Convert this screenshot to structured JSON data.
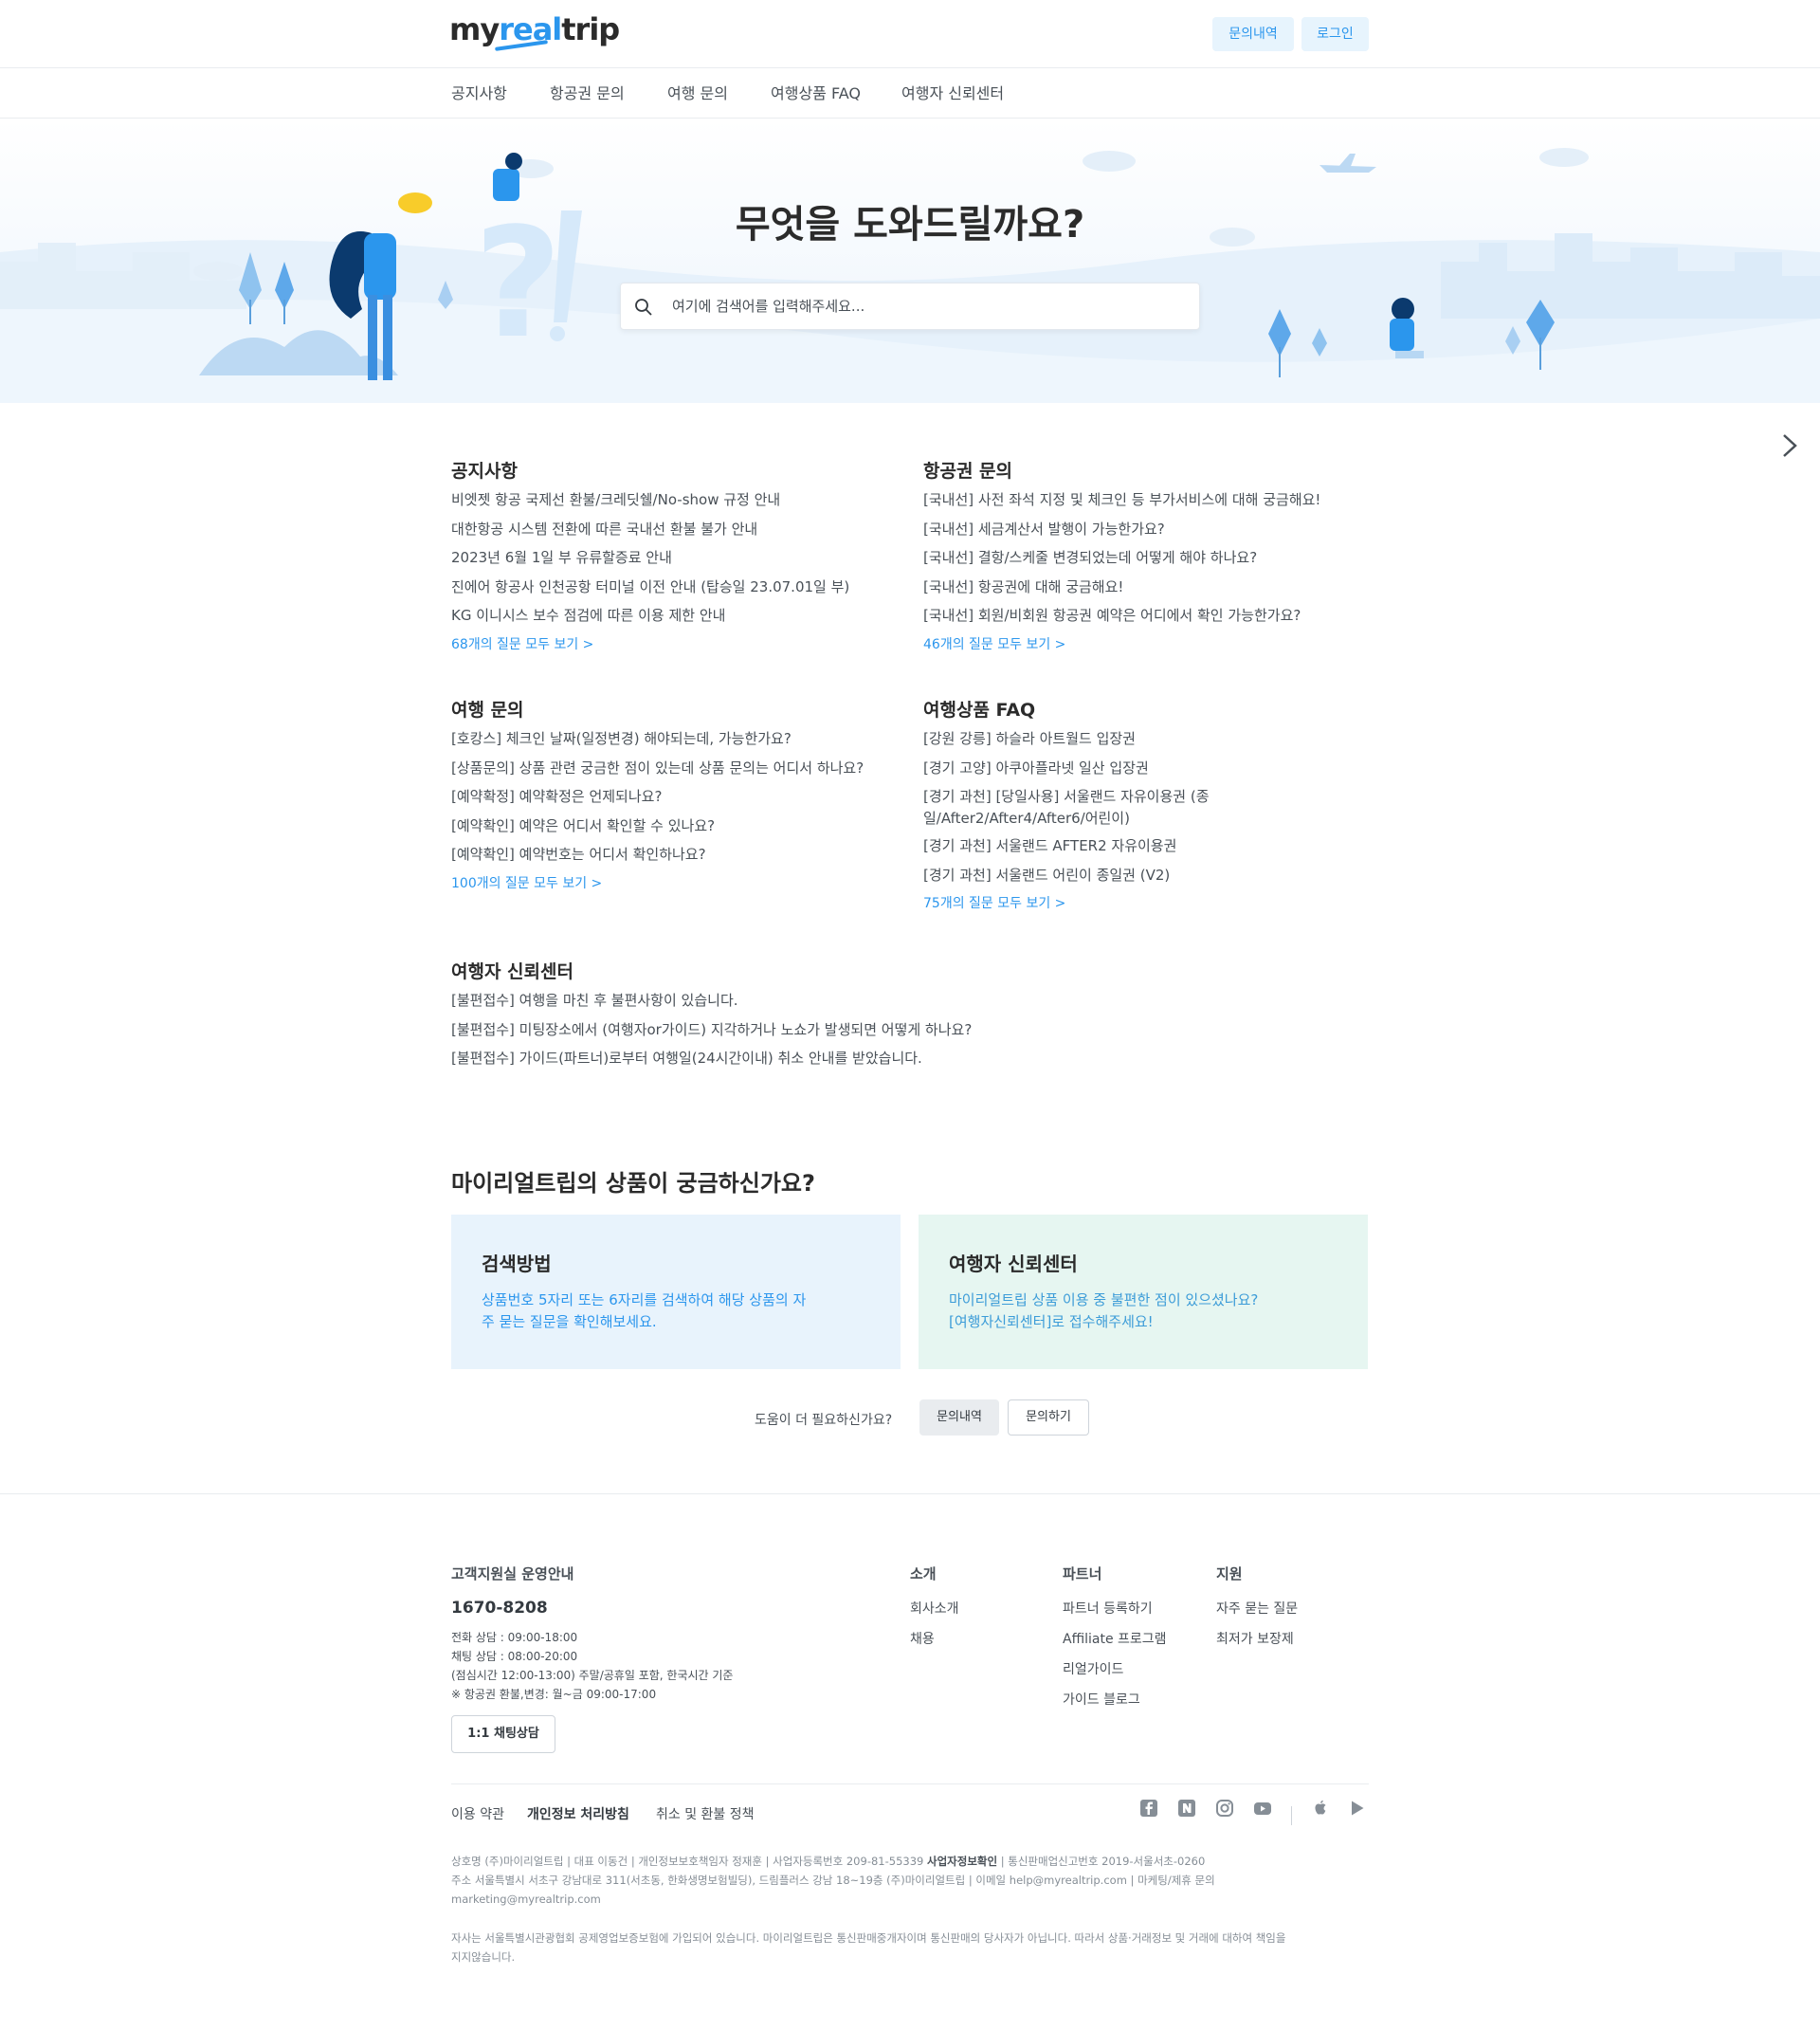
{
  "header": {
    "logo_my": "my",
    "logo_real": "real",
    "logo_trip": "trip",
    "inquiry_button": "문의내역",
    "login_button": "로그인"
  },
  "nav": {
    "items": [
      "공지사항",
      "항공권 문의",
      "여행 문의",
      "여행상품 FAQ",
      "여행자 신뢰센터"
    ]
  },
  "hero": {
    "title": "무엇을 도와드릴까요?",
    "search_placeholder": "여기에 검색어를 입력해주세요..."
  },
  "sections": {
    "notice": {
      "title": "공지사항",
      "items": [
        "비엣젯 항공 국제선 환불/크레딧쉘/No-show 규정 안내",
        "대한항공 시스템 전환에 따른 국내선 환불 불가 안내",
        "2023년 6월 1일 부 유류할증료 안내",
        "진에어 항공사 인천공항 터미널 이전 안내 (탑승일 23.07.01일 부)",
        "KG 이니시스 보수 점검에 따른 이용 제한 안내"
      ],
      "more": "68개의 질문 모두 보기 >"
    },
    "flight": {
      "title": "항공권 문의",
      "items": [
        "[국내선] 사전 좌석 지정 및 체크인 등 부가서비스에 대해 궁금해요!",
        "[국내선] 세금계산서 발행이 가능한가요?",
        "[국내선] 결항/스케줄 변경되었는데 어떻게 해야 하나요?",
        "[국내선] 항공권에 대해 궁금해요!",
        "[국내선] 회원/비회원 항공권 예약은 어디에서 확인 가능한가요?"
      ],
      "more": "46개의 질문 모두 보기 >"
    },
    "travel": {
      "title": "여행 문의",
      "items": [
        "[호캉스] 체크인 날짜(일정변경) 해야되는데, 가능한가요?",
        "[상품문의] 상품 관련 궁금한 점이 있는데 상품 문의는 어디서 하나요?",
        "[예약확정] 예약확정은 언제되나요?",
        "[예약확인] 예약은 어디서 확인할 수 있나요?",
        "[예약확인] 예약번호는 어디서 확인하나요?"
      ],
      "more": "100개의 질문 모두 보기 >"
    },
    "product_faq": {
      "title": "여행상품 FAQ",
      "items": [
        "[강원 강릉] 하슬라 아트월드 입장권",
        "[경기 고양] 아쿠아플라넷 일산 입장권",
        "[경기 과천] [당일사용] 서울랜드 자유이용권 (종일/After2/After4/After6/어린이)",
        "[경기 과천] 서울랜드 AFTER2 자유이용권",
        "[경기 과천] 서울랜드 어린이 종일권 (V2)"
      ],
      "more": "75개의 질문 모두 보기 >"
    },
    "trust": {
      "title": "여행자 신뢰센터",
      "items": [
        "[불편접수] 여행을 마친 후 불편사항이 있습니다.",
        "[불편접수] 미팅장소에서 (여행자or가이드) 지각하거나 노쇼가 발생되면 어떻게 하나요?",
        "[불편접수] 가이드(파트너)로부터 여행일(24시간이내) 취소 안내를 받았습니다."
      ]
    }
  },
  "products": {
    "title": "마이리얼트립의 상품이 궁금하신가요?",
    "search_card": {
      "title": "검색방법",
      "line1": "상품번호 5자리 또는 6자리를 검색하여 해당 상품의 자",
      "line2": "주 묻는 질문을 확인해보세요."
    },
    "trust_card": {
      "title": "여행자 신뢰센터",
      "line1": "마이리얼트립 상품 이용 중 불편한 점이 있으셨나요?",
      "line2": "[여행자신뢰센터]로 접수해주세요!"
    }
  },
  "help": {
    "text": "도움이 더 필요하신가요?",
    "inquiry_button": "문의내역",
    "ask_button": "문의하기"
  },
  "footer": {
    "cs_title": "고객지원실 운영안내",
    "phone": "1670-8208",
    "hours": [
      "전화 상담 : 09:00-18:00",
      "채팅 상담 : 08:00-20:00",
      "(점심시간 12:00-13:00) 주말/공휴일 포함, 한국시간 기준",
      "※ 항공권 환불,변경: 월~금 09:00-17:00"
    ],
    "chat_button": "1:1 채팅상담",
    "about": {
      "title": "소개",
      "links": [
        "회사소개",
        "채용"
      ]
    },
    "partner": {
      "title": "파트너",
      "links": [
        "파트너 등록하기",
        "Affiliate 프로그램",
        "리얼가이드",
        "가이드 블로그"
      ]
    },
    "support": {
      "title": "지원",
      "links": [
        "자주 묻는 질문",
        "최저가 보장제"
      ]
    },
    "legal": [
      "이용 약관",
      "개인정보 처리방침",
      "취소 및 환불 정책"
    ],
    "company_line1a": "상호명 (주)마이리얼트립 | 대표 이동건 | 개인정보보호책임자 정재훈 | 사업자등록번호 209-81-55339 ",
    "company_line1b": "사업자정보확인",
    "company_line1c": " | 통신판매업신고번호 2019-서울서초-0260",
    "company_line2": "주소 서울특별시 서초구 강남대로 311(서초동, 한화생명보험빌딩), 드림플러스 강남 18~19층 (주)마이리얼트립 | 이메일 help@myrealtrip.com | 마케팅/제휴 문의",
    "company_line3": "marketing@myrealtrip.com",
    "disclaimer1": "자사는 서울특별시관광협회 공제영업보증보험에 가입되어 있습니다. 마이리얼트립은 통신판매중개자이며 통신판매의 당사자가 아닙니다. 따라서 상품·거래정보 및 거래에 대하여 책임을",
    "disclaimer2": "지지않습니다."
  },
  "colors": {
    "brand": "#2b96ed",
    "text": "#343a40",
    "card_blue": "#e8f3fc",
    "card_green": "#e6f6f1"
  }
}
